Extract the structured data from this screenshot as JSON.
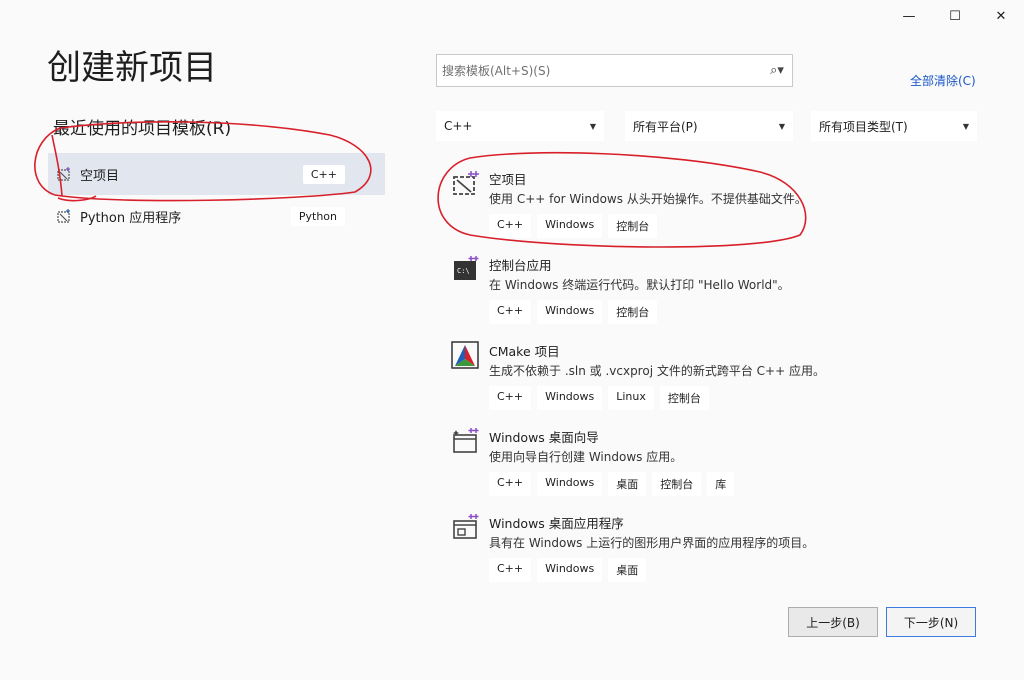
{
  "window": {
    "minimize_glyph": "—",
    "maximize_glyph": "☐",
    "close_glyph": "✕"
  },
  "page_title": "创建新项目",
  "recent": {
    "title": "最近使用的项目模板(R)",
    "items": [
      {
        "label": "空项目",
        "tag": "C++",
        "icon": "empty-project-icon"
      },
      {
        "label": "Python 应用程序",
        "tag": "Python",
        "icon": "python-app-icon"
      }
    ]
  },
  "search": {
    "placeholder": "搜索模板(Alt+S)(S)",
    "value": "",
    "clear_all": "全部清除(C)"
  },
  "filters": {
    "language": "C++",
    "platform": "所有平台(P)",
    "project_type": "所有项目类型(T)"
  },
  "templates": [
    {
      "name": "空项目",
      "desc": "使用 C++ for Windows 从头开始操作。不提供基础文件。",
      "tags": [
        "C++",
        "Windows",
        "控制台"
      ],
      "icon": "empty-project-icon"
    },
    {
      "name": "控制台应用",
      "desc": "在 Windows 终端运行代码。默认打印 \"Hello World\"。",
      "tags": [
        "C++",
        "Windows",
        "控制台"
      ],
      "icon": "console-app-icon"
    },
    {
      "name": "CMake 项目",
      "desc": "生成不依赖于 .sln 或 .vcxproj 文件的新式跨平台 C++ 应用。",
      "tags": [
        "C++",
        "Windows",
        "Linux",
        "控制台"
      ],
      "icon": "cmake-icon"
    },
    {
      "name": "Windows 桌面向导",
      "desc": "使用向导自行创建 Windows 应用。",
      "tags": [
        "C++",
        "Windows",
        "桌面",
        "控制台",
        "库"
      ],
      "icon": "desktop-wizard-icon"
    },
    {
      "name": "Windows 桌面应用程序",
      "desc": "具有在 Windows 上运行的图形用户界面的应用程序的项目。",
      "tags": [
        "C++",
        "Windows",
        "桌面"
      ],
      "icon": "desktop-app-icon"
    }
  ],
  "buttons": {
    "back": "上一步(B)",
    "next": "下一步(N)"
  },
  "colors": {
    "accent": "#3d7be0",
    "link": "#1a56c8",
    "selected_bg": "#e2e6ef",
    "annotation": "#d8202a"
  }
}
